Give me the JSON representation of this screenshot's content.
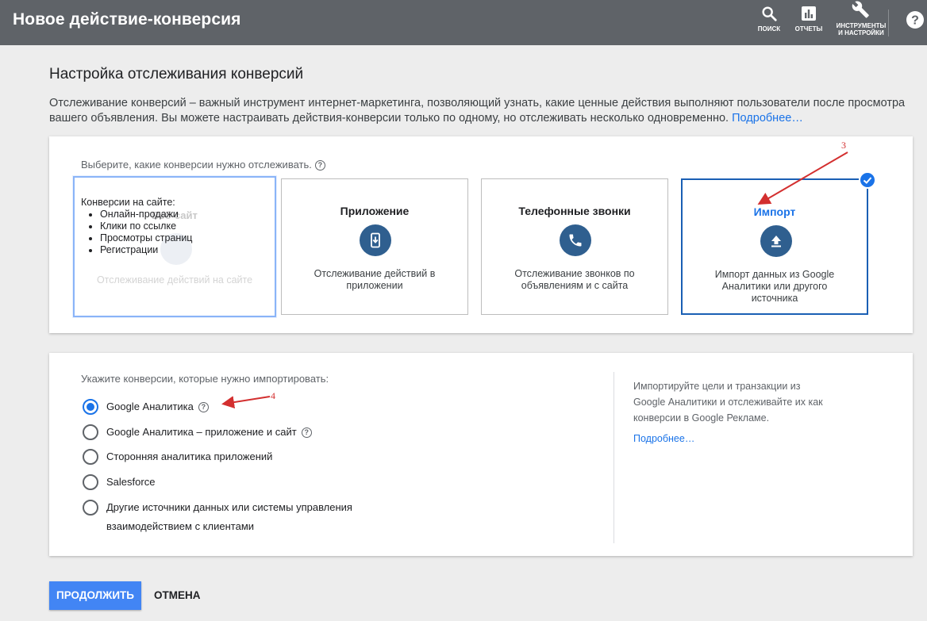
{
  "header": {
    "title": "Новое действие-конверсия",
    "search_label": "ПОИСК",
    "reports_label": "ОТЧЕТЫ",
    "tools_label_1": "ИНСТРУМЕНТЫ",
    "tools_label_2": "И НАСТРОЙКИ",
    "help_symbol": "?"
  },
  "intro": {
    "title": "Настройка отслеживания конверсий",
    "description": "Отслеживание конверсий – важный инструмент интернет-маркетинга, позволяющий узнать, какие ценные действия выполняют пользователи после просмотра вашего объявления. Вы можете настраивать действия-конверсии только по одному, но отслеживать несколько одновременно.",
    "more_link": "Подробнее…"
  },
  "conversion_types": {
    "prompt": "Выберите, какие конверсии нужно отслеживать.",
    "help_symbol": "?",
    "website": {
      "ghost_title": "Веб-сайт",
      "ghost_desc": "Отслеживание действий на сайте",
      "tooltip_title": "Конверсии на сайте:",
      "tooltip_items": [
        "Онлайн-продажи",
        "Клики по ссылке",
        "Просмотры страниц",
        "Регистрации"
      ]
    },
    "app": {
      "title": "Приложение",
      "icon": "phone-download-icon",
      "desc": "Отслеживание действий в приложении"
    },
    "calls": {
      "title": "Телефонные звонки",
      "icon": "phone-icon",
      "desc": "Отслеживание звонков по объявлениям и с сайта"
    },
    "import": {
      "title": "Импорт",
      "icon": "upload-icon",
      "desc": "Импорт данных из Google Аналитики или другого источника",
      "selected": true
    }
  },
  "import_sources": {
    "prompt": "Укажите конверсии, которые нужно импортировать:",
    "options": [
      {
        "label": "Google Аналитика",
        "selected": true,
        "help": "?"
      },
      {
        "label": "Google Аналитика – приложение и сайт",
        "selected": false,
        "help": "?"
      },
      {
        "label": "Сторонняя аналитика приложений",
        "selected": false
      },
      {
        "label": "Salesforce",
        "selected": false
      },
      {
        "label": "Другие источники данных или системы управления",
        "label_line2": "взаимодействием с клиентами",
        "selected": false
      }
    ],
    "side_text": "Импортируйте цели и транзакции из Google Аналитики и отслеживайте их как конверсии в Google Рекламе.",
    "side_more": "Подробнее…"
  },
  "actions": {
    "continue": "ПРОДОЛЖИТЬ",
    "cancel": "ОТМЕНА"
  },
  "annotations": {
    "label_3": "3",
    "label_4": "4",
    "color": "#d32f2f"
  },
  "colors": {
    "header_bg": "#5f6368",
    "accent": "#1a73e8",
    "icon_circle": "#2f5f8f",
    "continue_bg": "#4285f4"
  }
}
